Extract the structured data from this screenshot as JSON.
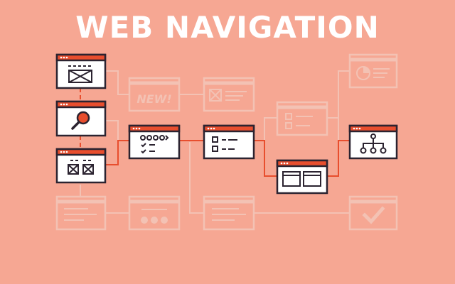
{
  "title": "WEB NAVIGATION",
  "colors": {
    "background": "#f6a793",
    "accent": "#e84e2e",
    "ink": "#2b2330",
    "muted": "#f3c2b4",
    "muted_ink": "#ea9a86",
    "card": "#ffffff"
  },
  "windows": [
    {
      "id": "hero-image-page",
      "icon": "image-placeholder-icon",
      "state": "active"
    },
    {
      "id": "search-page",
      "icon": "magnifier-icon",
      "state": "active"
    },
    {
      "id": "gallery-page",
      "icon": "image-grid-icon",
      "state": "active"
    },
    {
      "id": "new-badge-page",
      "icon": "new-badge-icon",
      "state": "faded",
      "label": "NEW!"
    },
    {
      "id": "media-text-page",
      "icon": "image-text-icon",
      "state": "faded"
    },
    {
      "id": "checklist-page",
      "icon": "checklist-icon",
      "state": "faded"
    },
    {
      "id": "pie-chart-page",
      "icon": "pie-chart-icon",
      "state": "faded"
    },
    {
      "id": "form-steps-page",
      "icon": "form-steps-icon",
      "state": "active"
    },
    {
      "id": "option-list-page",
      "icon": "option-list-icon",
      "state": "active"
    },
    {
      "id": "two-panel-page",
      "icon": "two-panel-icon",
      "state": "active"
    },
    {
      "id": "sitemap-page",
      "icon": "sitemap-icon",
      "state": "active"
    },
    {
      "id": "text-list-page",
      "icon": "text-lines-icon",
      "state": "faded"
    },
    {
      "id": "pagination-page",
      "icon": "pagination-icon",
      "state": "faded"
    },
    {
      "id": "article-page",
      "icon": "text-lines-icon",
      "state": "faded"
    },
    {
      "id": "done-page",
      "icon": "checkmark-icon",
      "state": "faded"
    }
  ]
}
